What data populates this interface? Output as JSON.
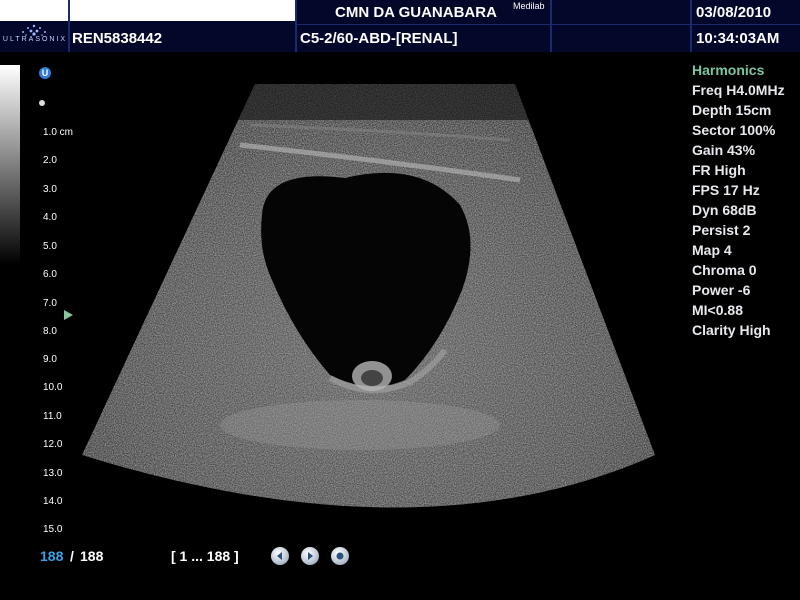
{
  "header": {
    "logo_text": "ULTRASONIX",
    "clinic": "CMN DA GUANABARA",
    "clinic_sup": "Medilab",
    "patient_id": "REN5838442",
    "probe": "C5-2/60-ABD-[RENAL]",
    "date": "03/08/2010",
    "time": "10:34:03AM"
  },
  "depth_scale": {
    "first_label": "1.0 cm",
    "labels": [
      "2.0",
      "3.0",
      "4.0",
      "5.0",
      "6.0",
      "7.0",
      "8.0",
      "9.0",
      "10.0",
      "11.0",
      "12.0",
      "13.0",
      "14.0",
      "15.0"
    ]
  },
  "icons": {
    "top": "u-icon",
    "u_letter": "U",
    "dot": "dot-icon",
    "focus": "focus-marker-icon"
  },
  "params": [
    "Harmonics",
    "Freq H4.0MHz",
    "Depth 15cm",
    "Sector 100%",
    "Gain 43%",
    "FR High",
    "FPS 17 Hz",
    "Dyn 68dB",
    "Persist 2",
    "Map 4",
    "Chroma 0",
    "Power -6",
    "MI<0.88",
    "Clarity High"
  ],
  "cine": {
    "current": "188",
    "separator": "/",
    "total": "188",
    "range": "[ 1 ... 188 ]"
  },
  "colors": {
    "header_bg": "#03072a",
    "frame_current": "#3aa1e6",
    "harmonics": "#7bc6a0"
  }
}
